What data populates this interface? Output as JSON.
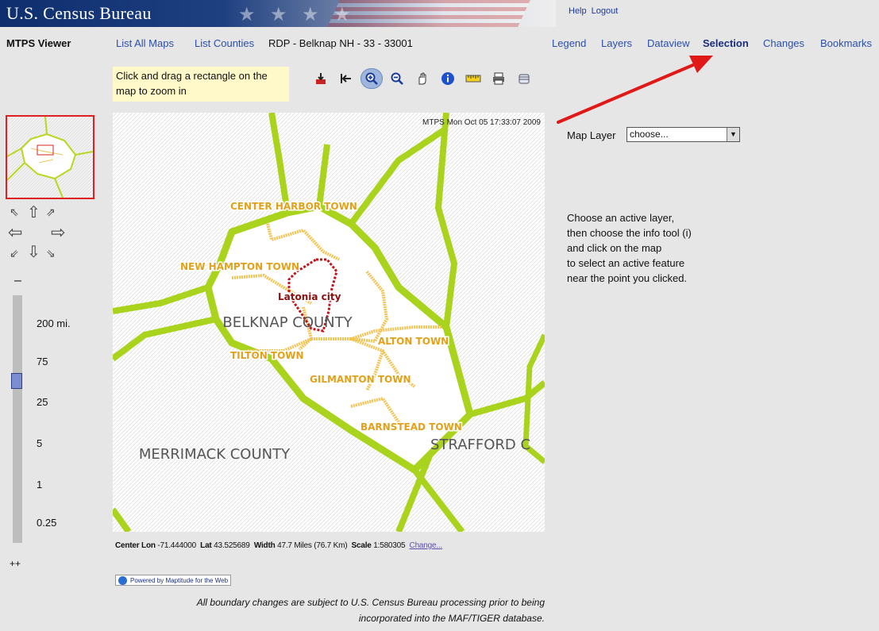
{
  "header": {
    "title": "U.S. Census Bureau",
    "help": "Help",
    "logout": "Logout"
  },
  "nav": {
    "app_name": "MTPS Viewer",
    "list_all_maps": "List All Maps",
    "list_counties": "List Counties",
    "breadcrumb": "RDP - Belknap NH - 33 - 33001",
    "tabs": [
      "Legend",
      "Layers",
      "Dataview",
      "Selection",
      "Changes",
      "Bookmarks"
    ],
    "selected_tab": "Selection"
  },
  "toolbar": {
    "hint": "Click and drag a rectangle on the map to zoom in",
    "tools": [
      "export-icon",
      "back-icon",
      "zoom-in-icon",
      "zoom-out-icon",
      "pan-hand-icon",
      "info-icon",
      "measure-icon",
      "print-icon",
      "database-icon"
    ],
    "active_tool": "zoom-in-icon"
  },
  "map": {
    "timestamp": "MTPS Mon Oct 05 17:33:07 2009",
    "county_labels": [
      "BELKNAP COUNTY",
      "MERRIMACK COUNTY",
      "STRAFFORD C"
    ],
    "town_labels": [
      "CENTER HARBOR TOWN",
      "NEW HAMPTON TOWN",
      "TILTON TOWN",
      "ALTON TOWN",
      "GILMANTON TOWN",
      "BARNSTEAD TOWN"
    ],
    "city_label": "Latonia city"
  },
  "zoom_scale": {
    "minus": "–",
    "plus": "++",
    "labels": [
      "200 mi.",
      "75",
      "25",
      "5",
      "1",
      "0.25"
    ]
  },
  "map_info": {
    "center_lon_label": "Center Lon",
    "center_lon": "-71.444000",
    "lat_label": "Lat",
    "lat": "43.525689",
    "width_label": "Width",
    "width": "47.7  Miles  (76.7 Km)",
    "scale_label": "Scale",
    "scale": "1:580305",
    "change": "Change..."
  },
  "powered_by": "Powered by Maptitude for the Web",
  "disclaimer_line1": "All boundary changes are subject to U.S. Census Bureau processing prior to being",
  "disclaimer_line2": "incorporated into the MAF/TIGER database.",
  "panel": {
    "map_layer_label": "Map Layer",
    "map_layer_value": "choose...",
    "instructions": [
      "Choose an active layer,",
      "then choose the info tool (i)",
      "and click on the map",
      "to select an active feature",
      "near the point you clicked."
    ]
  },
  "colors": {
    "accent_link": "#2b4fa8",
    "boundary_county": "#a9d31c",
    "boundary_town": "#f2c455",
    "town_label": "#e3a11a",
    "city": "#c0151a",
    "annotation_arrow": "#e01818"
  }
}
